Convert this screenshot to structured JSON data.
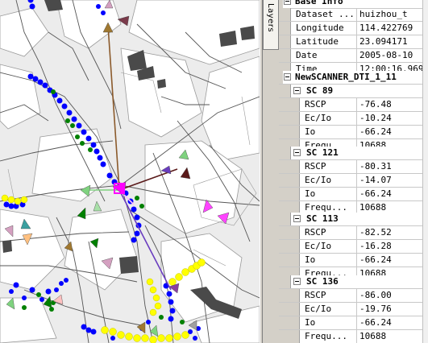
{
  "tab_layers_label": "Layers",
  "panel": {
    "base_title": "Base Info",
    "base_rows": [
      {
        "key": "Dataset ...",
        "value": "huizhou_t"
      },
      {
        "key": "Longitude",
        "value": "114.422769"
      },
      {
        "key": "Latitude",
        "value": "23.094171"
      },
      {
        "key": "Date",
        "value": "2005-08-10"
      },
      {
        "key": "Time",
        "value": "12:00:16.969"
      }
    ],
    "scanner_title": "NewSCANNER_DTI_1_11",
    "groups": [
      {
        "title": "SC 89",
        "rows": [
          {
            "key": "RSCP",
            "value": "-76.48"
          },
          {
            "key": "Ec/Io",
            "value": "-10.24"
          },
          {
            "key": "Io",
            "value": "-66.24"
          },
          {
            "key": "Frequ...",
            "value": "10688"
          }
        ]
      },
      {
        "title": "SC 121",
        "rows": [
          {
            "key": "RSCP",
            "value": "-80.31"
          },
          {
            "key": "Ec/Io",
            "value": "-14.07"
          },
          {
            "key": "Io",
            "value": "-66.24"
          },
          {
            "key": "Frequ...",
            "value": "10688"
          }
        ]
      },
      {
        "title": "SC 113",
        "rows": [
          {
            "key": "RSCP",
            "value": "-82.52"
          },
          {
            "key": "Ec/Io",
            "value": "-16.28"
          },
          {
            "key": "Io",
            "value": "-66.24"
          },
          {
            "key": "Frequ...",
            "value": "10688"
          }
        ]
      },
      {
        "title": "SC 136",
        "rows": [
          {
            "key": "RSCP",
            "value": "-86.00"
          },
          {
            "key": "Ec/Io",
            "value": "-19.76"
          },
          {
            "key": "Io",
            "value": "-66.24"
          },
          {
            "key": "Frequ...",
            "value": "10688"
          }
        ]
      }
    ]
  },
  "colors": {
    "route_blue": "#0000ff",
    "route_yellow": "#ffff00",
    "route_green": "#008000",
    "line_brown": "#8b5a2b",
    "line_purple": "#6a3dbf",
    "serving_magenta": "#ff00ff",
    "building": "#4a4a4a",
    "map_bg": "#ececec"
  }
}
